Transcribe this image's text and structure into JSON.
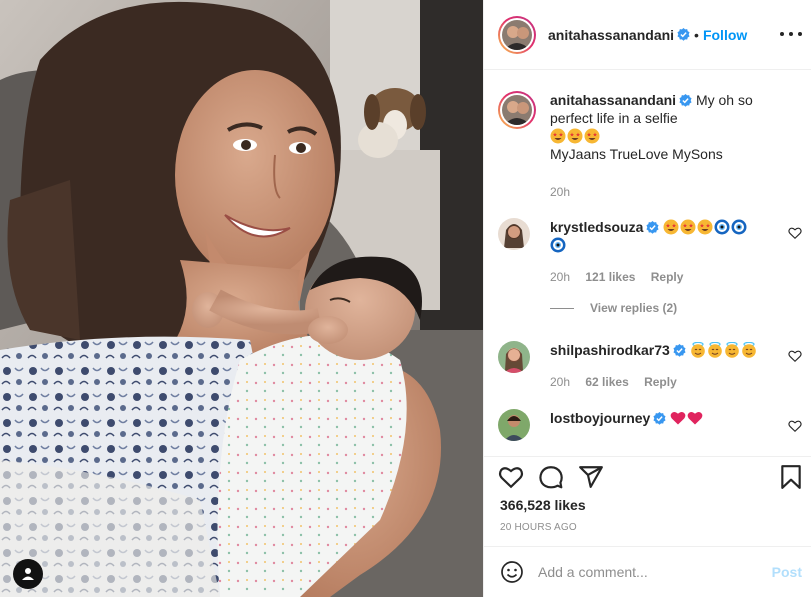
{
  "post": {
    "author": "anitahassanandani",
    "follow_label": "Follow",
    "dot": "•",
    "caption": {
      "line1": "My oh so",
      "line2": "perfect life in a selfie",
      "emojis": [
        "star-struck",
        "star-struck",
        "star-struck"
      ],
      "line3": "MyJaans TrueLove MySons",
      "time": "20h"
    },
    "likes": "366,528 likes",
    "timestamp": "20 HOURS AGO"
  },
  "comments": [
    {
      "user": "krystledsouza",
      "emojis": [
        "star-struck",
        "star-struck",
        "star-struck",
        "evil-eye",
        "evil-eye",
        "evil-eye"
      ],
      "time": "20h",
      "likes": "121 likes",
      "reply": "Reply"
    },
    {
      "user": "shilpashirodkar73",
      "emojis": [
        "smiling-halo",
        "smiling-halo",
        "smiling-halo",
        "smiling-halo"
      ],
      "time": "20h",
      "likes": "62 likes",
      "reply": "Reply"
    },
    {
      "user": "lostboyjourney",
      "emojis": [
        "red-heart",
        "red-heart"
      ]
    }
  ],
  "view_replies": "View replies (2)",
  "add_comment": {
    "placeholder": "Add a comment...",
    "post_label": "Post"
  },
  "colors": {
    "link_blue": "#0095f6",
    "post_disabled": "#b2dffc",
    "muted": "#8e8e8e",
    "text": "#262626"
  }
}
